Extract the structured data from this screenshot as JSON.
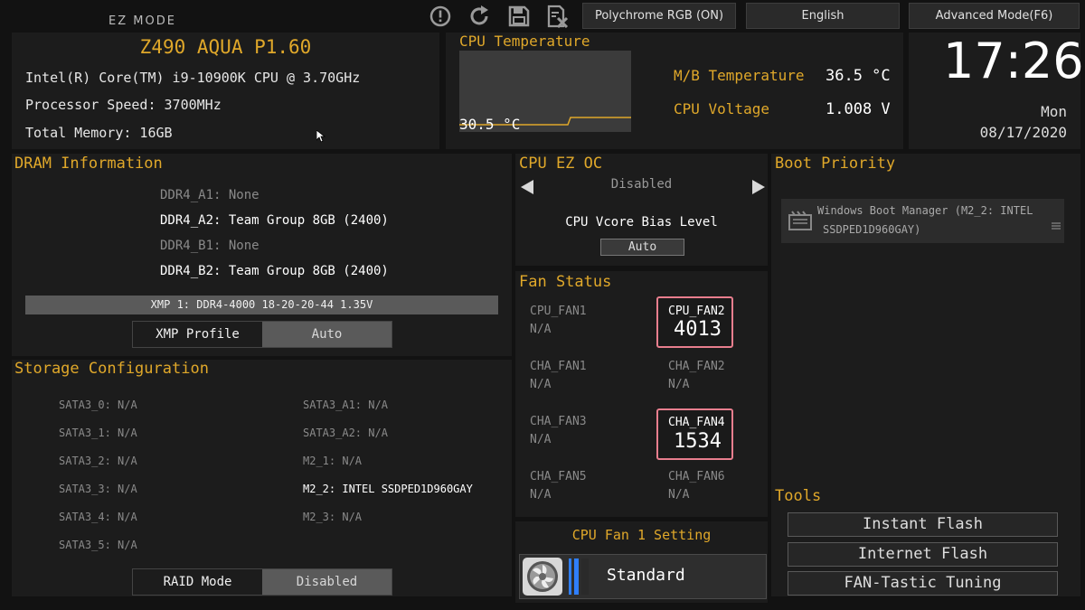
{
  "topbar": {
    "mode_label": "EZ MODE",
    "icons": [
      "info-icon",
      "refresh-icon",
      "save-icon",
      "discard-icon"
    ],
    "polychrome_label": "Polychrome RGB (ON)",
    "language_label": "English",
    "advanced_label": "Advanced Mode(F6)"
  },
  "sysinfo": {
    "title": "Z490 AQUA P1.60",
    "cpu": "Intel(R) Core(TM) i9-10900K CPU @ 3.70GHz",
    "speed": "Processor Speed: 3700MHz",
    "memory": "Total Memory: 16GB"
  },
  "temperature": {
    "title": "CPU Temperature",
    "cpu_temp": "30.5 °C",
    "mb_label": "M/B Temperature",
    "mb_value": "36.5 °C",
    "volt_label": "CPU Voltage",
    "volt_value": "1.008 V"
  },
  "clock": {
    "time": "17:26",
    "day": "Mon",
    "date": "08/17/2020"
  },
  "dram": {
    "title": "DRAM Information",
    "slots": [
      {
        "label": "DDR4_A1: None",
        "populated": false
      },
      {
        "label": "DDR4_A2: Team Group 8GB (2400)",
        "populated": true
      },
      {
        "label": "DDR4_B1: None",
        "populated": false
      },
      {
        "label": "DDR4_B2: Team Group 8GB (2400)",
        "populated": true
      }
    ],
    "xmp_info": "XMP 1: DDR4-4000 18-20-20-44 1.35V",
    "xmp_label": "XMP Profile",
    "xmp_value": "Auto"
  },
  "storage": {
    "title": "Storage Configuration",
    "left": [
      "SATA3_0: N/A",
      "SATA3_1: N/A",
      "SATA3_2: N/A",
      "SATA3_3: N/A",
      "SATA3_4: N/A",
      "SATA3_5: N/A"
    ],
    "right": [
      {
        "label": "SATA3_A1: N/A",
        "active": false
      },
      {
        "label": "SATA3_A2: N/A",
        "active": false
      },
      {
        "label": "M2_1: N/A",
        "active": false
      },
      {
        "label": "M2_2: INTEL SSDPED1D960GAY",
        "active": true
      },
      {
        "label": "M2_3: N/A",
        "active": false
      }
    ],
    "raid_label": "RAID Mode",
    "raid_value": "Disabled"
  },
  "ezoc": {
    "title": "CPU EZ OC",
    "value": "Disabled",
    "vcore_label": "CPU Vcore Bias Level",
    "vcore_value": "Auto"
  },
  "fan": {
    "title": "Fan Status",
    "fans": [
      {
        "name": "CPU_FAN1",
        "value": "N/A"
      },
      {
        "name": "CPU_FAN2",
        "value": "4013"
      },
      {
        "name": "CHA_FAN1",
        "value": "N/A"
      },
      {
        "name": "CHA_FAN2",
        "value": "N/A"
      },
      {
        "name": "CHA_FAN3",
        "value": "N/A"
      },
      {
        "name": "CHA_FAN4",
        "value": "1534"
      },
      {
        "name": "CHA_FAN5",
        "value": "N/A"
      },
      {
        "name": "CHA_FAN6",
        "value": "N/A"
      }
    ],
    "setting_title": "CPU Fan 1 Setting",
    "setting_value": "Standard"
  },
  "boot": {
    "title": "Boot Priority",
    "item_line1": "Windows Boot Manager (M2_2: INTEL",
    "item_line2": "SSDPED1D960GAY)"
  },
  "tools": {
    "title": "Tools",
    "buttons": [
      "Instant Flash",
      "Internet Flash",
      "FAN-Tastic Tuning"
    ]
  },
  "colors": {
    "accent": "#e0a82a",
    "highlight_border": "#e87e8e",
    "fan_bar": "#2f7fff"
  }
}
